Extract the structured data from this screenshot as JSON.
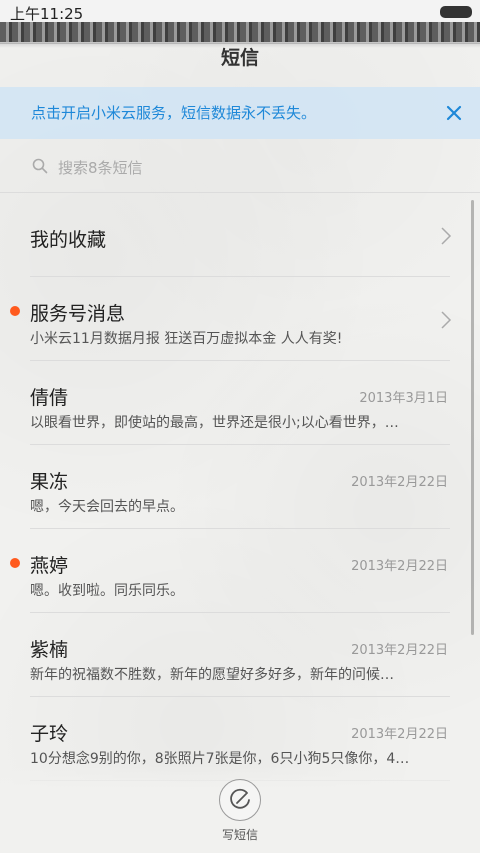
{
  "status_bar": {
    "time": "上午11:25"
  },
  "title": "短信",
  "banner": {
    "text": "点击开启小米云服务，短信数据永不丢失。"
  },
  "search": {
    "placeholder": "搜索8条短信"
  },
  "favorites": {
    "label": "我的收藏"
  },
  "conversations": [
    {
      "name": "服务号消息",
      "snippet": "小米云11月数据月报 狂送百万虚拟本金 人人有奖!",
      "date": "",
      "unread": true,
      "chevron": true
    },
    {
      "name": "倩倩",
      "snippet": "以眼看世界，即使站的最高，世界还是很小;以心看世界，…",
      "date": "2013年3月1日",
      "unread": false
    },
    {
      "name": "果冻",
      "snippet": "嗯，今天会回去的早点。",
      "date": "2013年2月22日",
      "unread": false
    },
    {
      "name": "燕婷",
      "snippet": "嗯。收到啦。同乐同乐。",
      "date": "2013年2月22日",
      "unread": true
    },
    {
      "name": "紫楠",
      "snippet": "新年的祝福数不胜数，新年的愿望好多好多，新年的问候…",
      "date": "2013年2月22日",
      "unread": false
    },
    {
      "name": "子玲",
      "snippet": "10分想念9别的你，8张照片7张是你，6只小狗5只像你，4…",
      "date": "2013年2月22日",
      "unread": false
    }
  ],
  "compose": {
    "label": "写短信"
  },
  "colors": {
    "accent": "#1e88d8",
    "unread_dot": "#ff5a1e",
    "banner_bg": "#d0e4f4"
  }
}
